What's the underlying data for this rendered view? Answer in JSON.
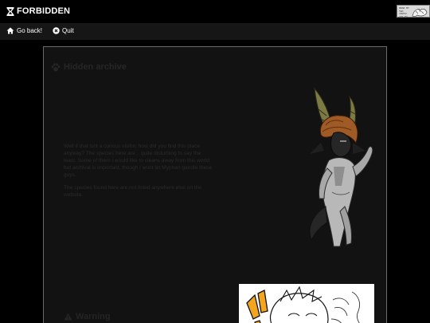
{
  "brand": {
    "title": "FORBIDDEN",
    "icon": "hourglass-icon"
  },
  "corner_badge": {
    "text": "DRAW MY TWO CENTS! ART BY MYPHAN",
    "icon": "doodle-badge"
  },
  "nav": {
    "items": [
      {
        "label": "Go back!",
        "icon": "home-icon"
      },
      {
        "label": "Quit",
        "icon": "x-circle-icon"
      }
    ]
  },
  "archive": {
    "title": "Hidden archive",
    "title_icon": "paw-icon",
    "paragraphs": [
      "Well if that isnt a curious visitor, how did you find this place anyway? The species here are... quite disturbing to say the least. Some of them i would like to cleans away from this world but archival is important, though i wont let Myphan gandle these guys.",
      "The species found here are not listed anywhere else on the website."
    ]
  },
  "warning": {
    "title": "Warning",
    "icon": "warning-triangle-icon"
  },
  "colors": {
    "background": "#000000",
    "navbar": "#161616",
    "panel": "#121212",
    "panel_border": "#6a6a6a",
    "dim_text": "#2b2b2b"
  }
}
